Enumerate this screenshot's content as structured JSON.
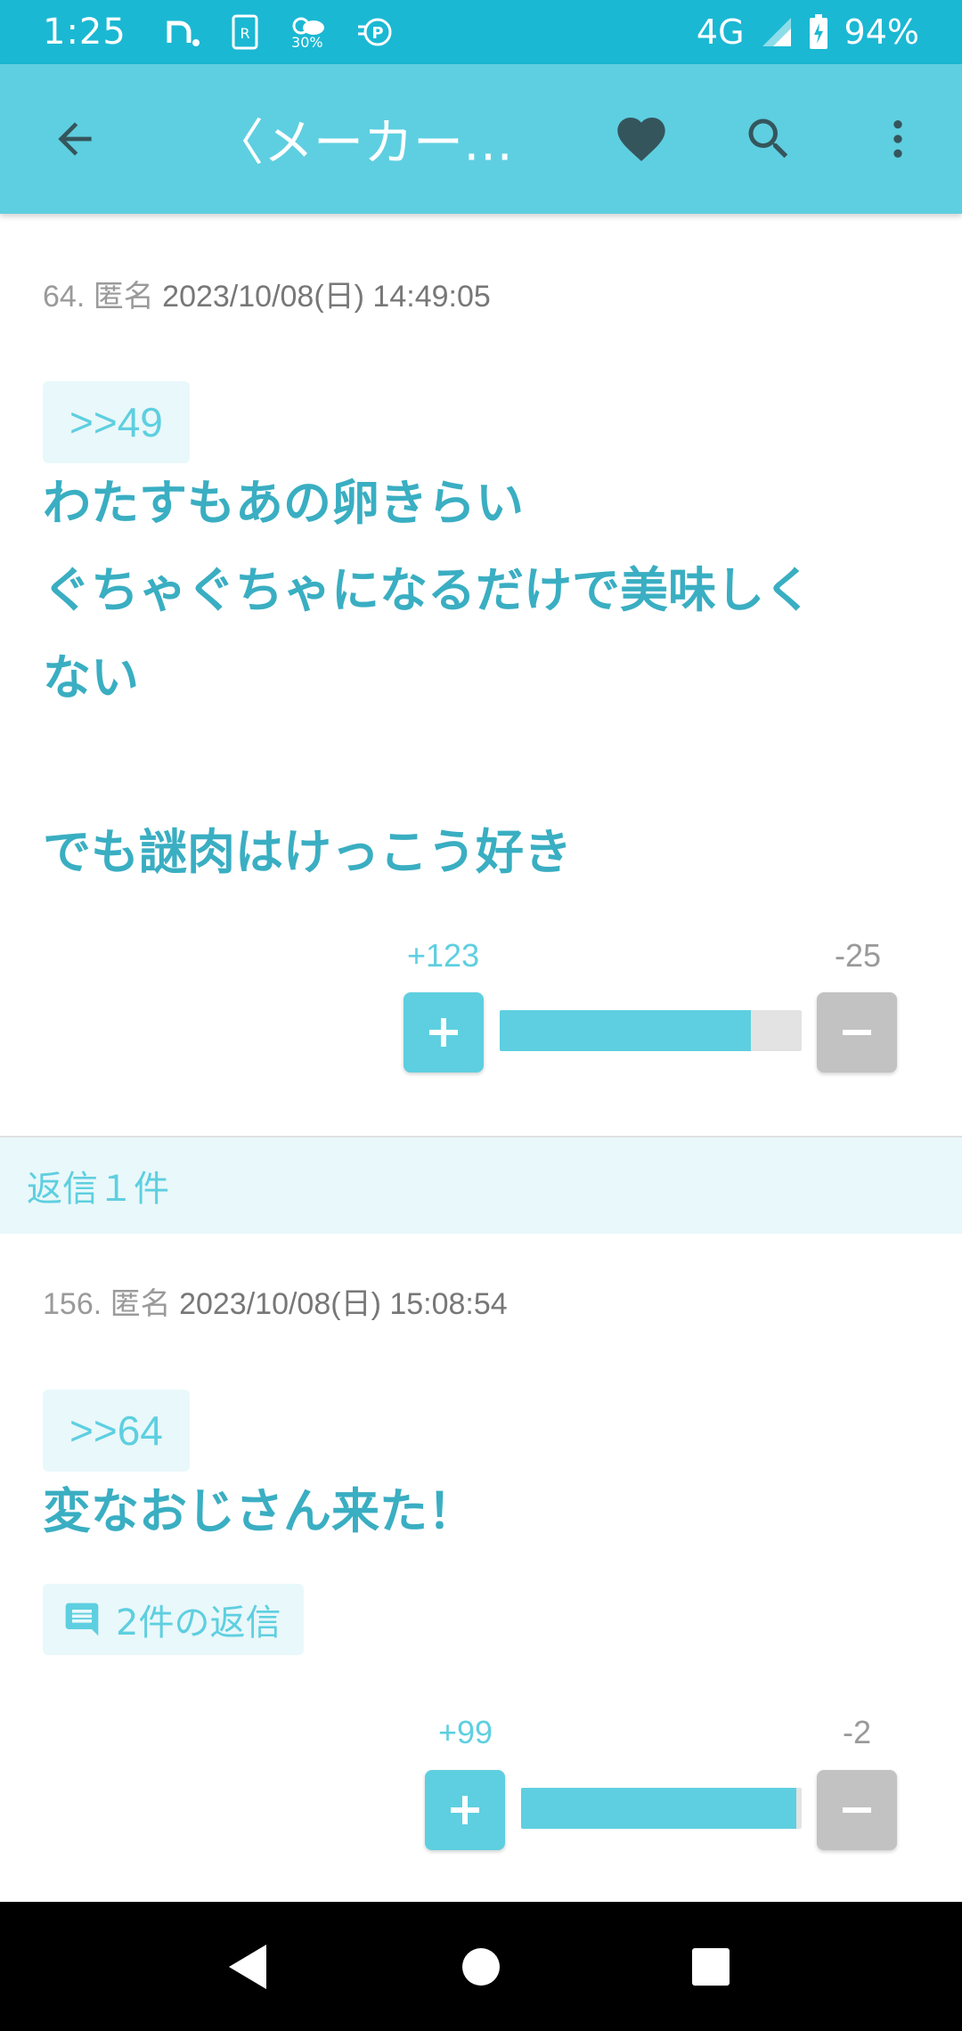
{
  "status_bar": {
    "time": "1:25",
    "weather_percent": "30%",
    "network": "4G",
    "battery": "94%"
  },
  "app_bar": {
    "title": "〈メーカーさ…",
    "icons": [
      "back-arrow-icon",
      "heart-icon",
      "search-icon",
      "more-vert-icon"
    ]
  },
  "colors": {
    "status_bar": "#1bb8d3",
    "app_bar": "#5ecfe0",
    "accent_text": "#3aaec2",
    "minus": "#c2c2c2",
    "reply_bg": "#e9f8fa"
  },
  "posts": [
    {
      "number_label": "64. 匿名",
      "datetime": "2023/10/08(日) 14:49:05",
      "anchor": ">>49",
      "lines": [
        "わたすもあの卵きらい",
        "ぐちゃぐちゃになるだけで美味しく",
        "ない",
        "",
        "でも謎肉はけっこう好き"
      ],
      "plus_count": "+123",
      "minus_count": "-25",
      "plus_ratio": 0.8311
    },
    {
      "number_label": "156. 匿名",
      "datetime": "2023/10/08(日) 15:08:54",
      "anchor": ">>64",
      "lines": [
        "変なおじさん来た！"
      ],
      "reply_chip": "2件の返信",
      "plus_count": "+99",
      "minus_count": "-2",
      "plus_ratio": 0.9802
    }
  ],
  "replies_header": "返信１件"
}
